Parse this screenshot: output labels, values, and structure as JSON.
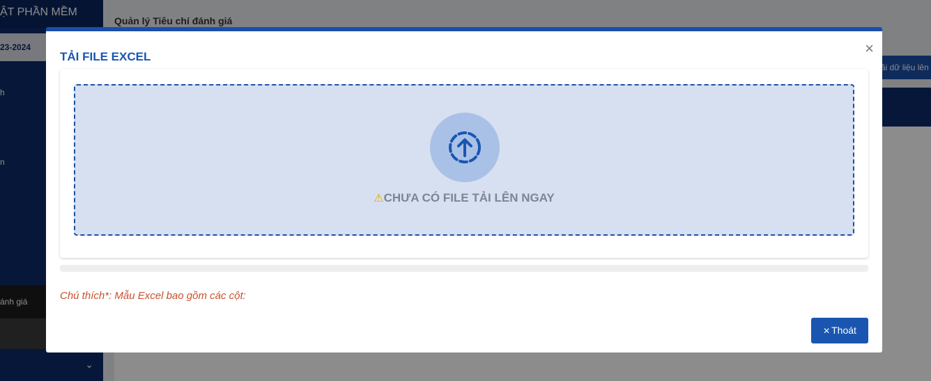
{
  "app": {
    "brand": "ẬT PHẦN MỀM",
    "year": "23-2024",
    "sidebar_items": [
      "h",
      "n",
      "ánh giá"
    ]
  },
  "main": {
    "breadcrumb": "Quản lý Tiêu chí đánh giá",
    "upload_button": "ải dữ liệu lên"
  },
  "modal": {
    "title": "TẢI FILE EXCEL",
    "close_label": "×",
    "empty_message": "CHƯA CÓ FILE TẢI LÊN NGAY",
    "note": "Chú thích*: Mẫu Excel bao gồm các cột:",
    "exit_label": "Thoát",
    "icons": [
      "upload-icon",
      "warning-icon",
      "close-icon"
    ]
  },
  "colors": {
    "primary": "#1a56b0",
    "sidebar": "#0d2b6b",
    "dropzone_bg": "#d6e0f0",
    "note": "#c8502d"
  }
}
